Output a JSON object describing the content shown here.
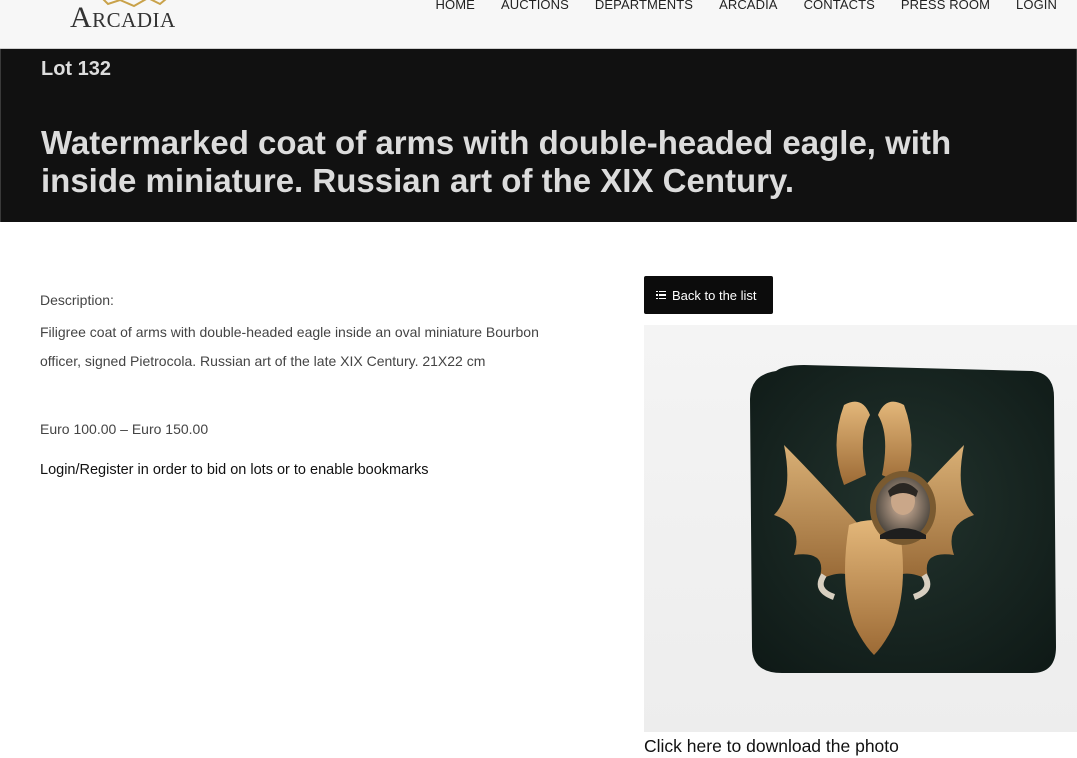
{
  "header": {
    "logo_text": "Arcadia",
    "nav": [
      "HOME",
      "AUCTIONS",
      "DEPARTMENTS",
      "ARCADIA",
      "CONTACTS",
      "PRESS ROOM",
      "LOGIN"
    ]
  },
  "lot": {
    "number": "Lot 132",
    "title": "Watermarked coat of arms with double-headed eagle, with inside miniature. Russian art of the XIX Century.",
    "description_label": "Description:",
    "description": "Filigree coat of arms with double-headed eagle inside an oval miniature Bourbon officer, signed Pietrocola. Russian art of the late XIX Century. 21X22 cm",
    "estimate": "Euro 100.00 – Euro 150.00",
    "login_note": "Login/Register in order to bid on lots or to enable bookmarks"
  },
  "actions": {
    "back_label": "Back to the list",
    "download_label": "Click here to download the photo"
  },
  "icons": {
    "back": "list-icon",
    "logo": "horse-logo-icon"
  },
  "colors": {
    "title_band": "#111111",
    "button": "#0c0c0c",
    "logo_gold": "#c9a24a"
  }
}
